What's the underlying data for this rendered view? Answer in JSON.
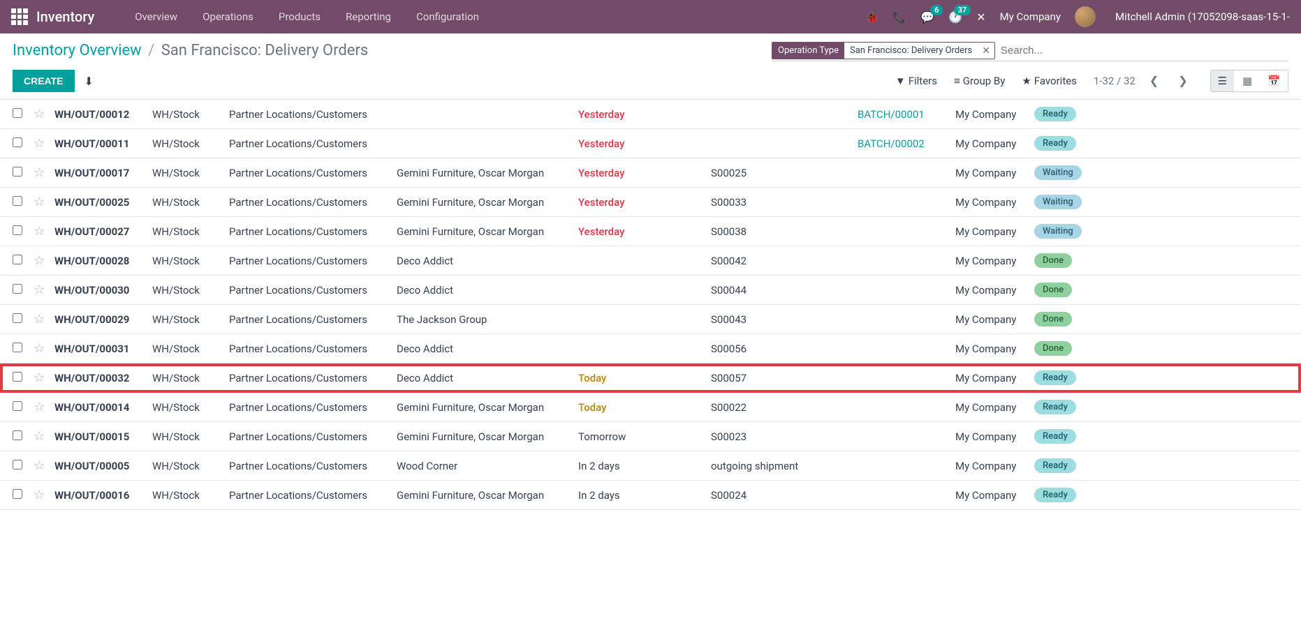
{
  "nav": {
    "brand": "Inventory",
    "menu": [
      "Overview",
      "Operations",
      "Products",
      "Reporting",
      "Configuration"
    ],
    "chat_badge": "6",
    "activity_badge": "37",
    "company": "My Company",
    "user": "Mitchell Admin (17052098-saas-15-1-"
  },
  "breadcrumb": {
    "parent": "Inventory Overview",
    "current": "San Francisco: Delivery Orders"
  },
  "search": {
    "facet_label": "Operation Type",
    "facet_value": "San Francisco: Delivery Orders",
    "placeholder": "Search..."
  },
  "buttons": {
    "create": "CREATE"
  },
  "search_options": {
    "filters": "Filters",
    "group_by": "Group By",
    "favorites": "Favorites"
  },
  "pager": {
    "range": "1-32 / 32"
  },
  "statuses": {
    "ready": "Ready",
    "waiting": "Waiting",
    "done": "Done"
  },
  "rows": [
    {
      "ref": "WH/OUT/00012",
      "from": "WH/Stock",
      "to": "Partner Locations/Customers",
      "contact": "",
      "sched": "Yesterday",
      "sched_class": "red",
      "src": "",
      "batch": "BATCH/00001",
      "company": "My Company",
      "status": "ready",
      "hl": false
    },
    {
      "ref": "WH/OUT/00011",
      "from": "WH/Stock",
      "to": "Partner Locations/Customers",
      "contact": "",
      "sched": "Yesterday",
      "sched_class": "red",
      "src": "",
      "batch": "BATCH/00002",
      "company": "My Company",
      "status": "ready",
      "hl": false
    },
    {
      "ref": "WH/OUT/00017",
      "from": "WH/Stock",
      "to": "Partner Locations/Customers",
      "contact": "Gemini Furniture, Oscar Morgan",
      "sched": "Yesterday",
      "sched_class": "red",
      "src": "S00025",
      "batch": "",
      "company": "My Company",
      "status": "waiting",
      "hl": false
    },
    {
      "ref": "WH/OUT/00025",
      "from": "WH/Stock",
      "to": "Partner Locations/Customers",
      "contact": "Gemini Furniture, Oscar Morgan",
      "sched": "Yesterday",
      "sched_class": "red",
      "src": "S00033",
      "batch": "",
      "company": "My Company",
      "status": "waiting",
      "hl": false
    },
    {
      "ref": "WH/OUT/00027",
      "from": "WH/Stock",
      "to": "Partner Locations/Customers",
      "contact": "Gemini Furniture, Oscar Morgan",
      "sched": "Yesterday",
      "sched_class": "red",
      "src": "S00038",
      "batch": "",
      "company": "My Company",
      "status": "waiting",
      "hl": false
    },
    {
      "ref": "WH/OUT/00028",
      "from": "WH/Stock",
      "to": "Partner Locations/Customers",
      "contact": "Deco Addict",
      "sched": "",
      "sched_class": "",
      "src": "S00042",
      "batch": "",
      "company": "My Company",
      "status": "done",
      "hl": false
    },
    {
      "ref": "WH/OUT/00030",
      "from": "WH/Stock",
      "to": "Partner Locations/Customers",
      "contact": "Deco Addict",
      "sched": "",
      "sched_class": "",
      "src": "S00044",
      "batch": "",
      "company": "My Company",
      "status": "done",
      "hl": false
    },
    {
      "ref": "WH/OUT/00029",
      "from": "WH/Stock",
      "to": "Partner Locations/Customers",
      "contact": "The Jackson Group",
      "sched": "",
      "sched_class": "",
      "src": "S00043",
      "batch": "",
      "company": "My Company",
      "status": "done",
      "hl": false
    },
    {
      "ref": "WH/OUT/00031",
      "from": "WH/Stock",
      "to": "Partner Locations/Customers",
      "contact": "Deco Addict",
      "sched": "",
      "sched_class": "",
      "src": "S00056",
      "batch": "",
      "company": "My Company",
      "status": "done",
      "hl": false
    },
    {
      "ref": "WH/OUT/00032",
      "from": "WH/Stock",
      "to": "Partner Locations/Customers",
      "contact": "Deco Addict",
      "sched": "Today",
      "sched_class": "orange",
      "src": "S00057",
      "batch": "",
      "company": "My Company",
      "status": "ready",
      "hl": true
    },
    {
      "ref": "WH/OUT/00014",
      "from": "WH/Stock",
      "to": "Partner Locations/Customers",
      "contact": "Gemini Furniture, Oscar Morgan",
      "sched": "Today",
      "sched_class": "orange",
      "src": "S00022",
      "batch": "",
      "company": "My Company",
      "status": "ready",
      "hl": false
    },
    {
      "ref": "WH/OUT/00015",
      "from": "WH/Stock",
      "to": "Partner Locations/Customers",
      "contact": "Gemini Furniture, Oscar Morgan",
      "sched": "Tomorrow",
      "sched_class": "",
      "src": "S00023",
      "batch": "",
      "company": "My Company",
      "status": "ready",
      "hl": false
    },
    {
      "ref": "WH/OUT/00005",
      "from": "WH/Stock",
      "to": "Partner Locations/Customers",
      "contact": "Wood Corner",
      "sched": "In 2 days",
      "sched_class": "",
      "src": "outgoing shipment",
      "batch": "",
      "company": "My Company",
      "status": "ready",
      "hl": false
    },
    {
      "ref": "WH/OUT/00016",
      "from": "WH/Stock",
      "to": "Partner Locations/Customers",
      "contact": "Gemini Furniture, Oscar Morgan",
      "sched": "In 2 days",
      "sched_class": "",
      "src": "S00024",
      "batch": "",
      "company": "My Company",
      "status": "ready",
      "hl": false
    }
  ]
}
